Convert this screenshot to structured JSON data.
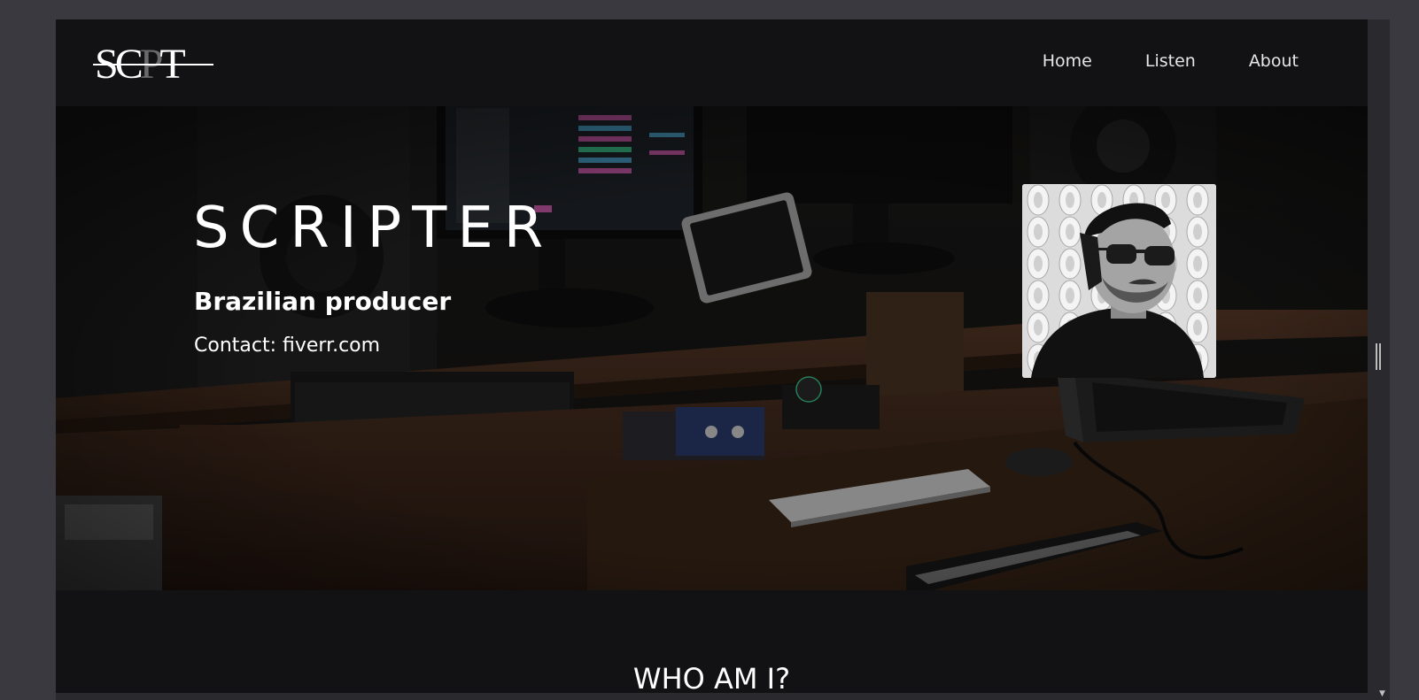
{
  "nav": {
    "logo_text": "SCPT",
    "links": [
      "Home",
      "Listen",
      "About"
    ]
  },
  "hero": {
    "title": "SCRIPTER",
    "subtitle": "Brazilian producer",
    "contact_label": "Contact: ",
    "contact_link": "fiverr.com"
  },
  "about": {
    "heading": "WHO AM I?"
  },
  "colors": {
    "page_bg": "#121214",
    "outer_bg": "#3a393f",
    "text": "#ffffff",
    "nav_text": "#e6e6e6"
  },
  "icons": {
    "scroll_down": "▼"
  }
}
